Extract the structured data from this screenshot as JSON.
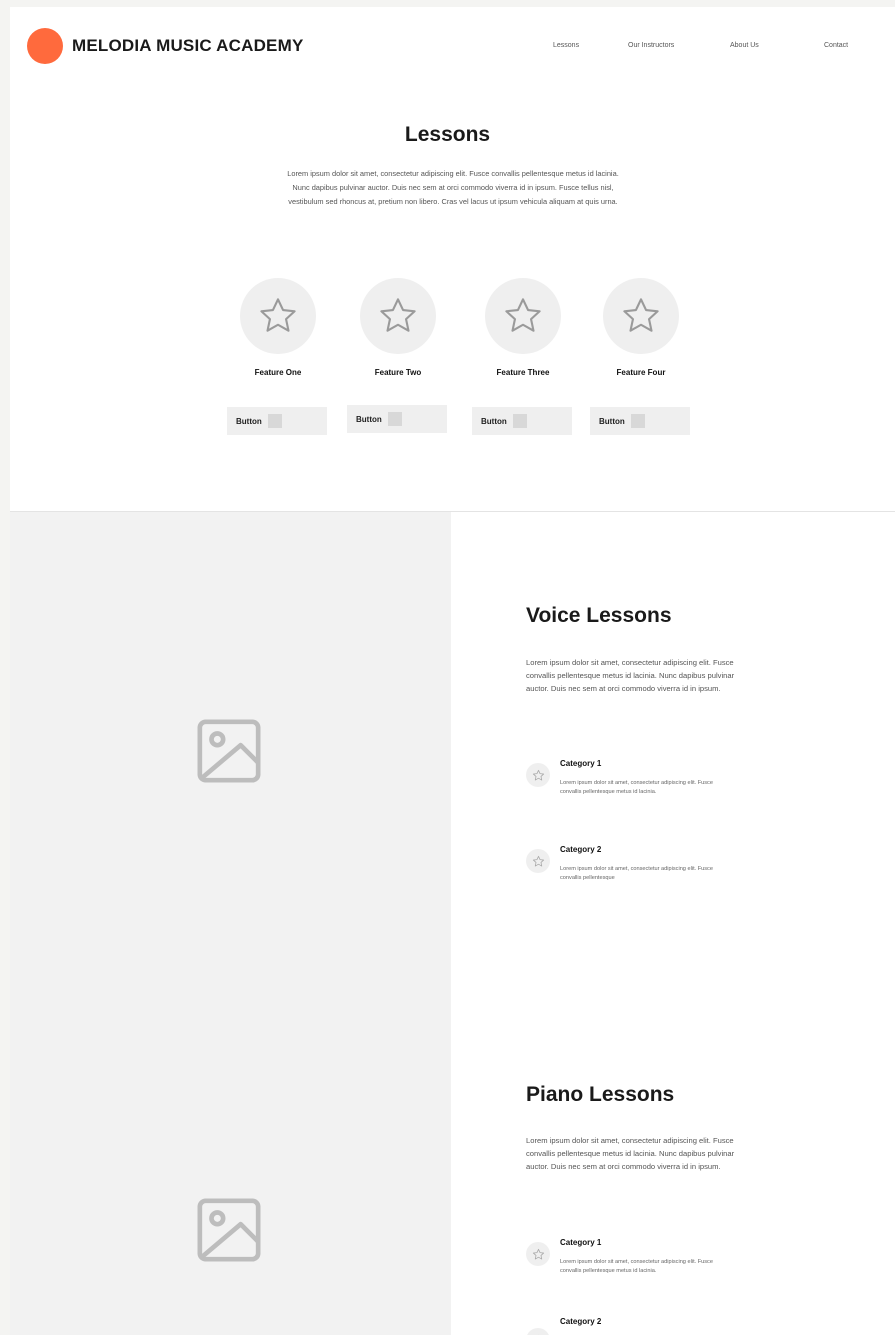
{
  "header": {
    "brand": "MELODIA MUSIC ACADEMY",
    "brand_color": "#ff6a3d",
    "nav": [
      "Lessons",
      "Our Instructors",
      "About Us",
      "Contact"
    ]
  },
  "lessons": {
    "title": "Lessons",
    "description": "Lorem ipsum dolor sit amet, consectetur adipiscing elit. Fusce convallis pellentesque metus id lacinia. Nunc dapibus pulvinar auctor. Duis nec sem at orci commodo viverra id in ipsum. Fusce tellus nisl, vestibulum sed rhoncus at, pretium non libero. Cras vel lacus ut ipsum vehicula aliquam at quis urna.",
    "features": [
      {
        "label": "Feature One",
        "icon": "star-icon",
        "button": "Button"
      },
      {
        "label": "Feature Two",
        "icon": "star-icon",
        "button": "Button"
      },
      {
        "label": "Feature Three",
        "icon": "star-icon",
        "button": "Button"
      },
      {
        "label": "Feature Four",
        "icon": "star-icon",
        "button": "Button"
      }
    ]
  },
  "sections": [
    {
      "title": "Voice Lessons",
      "description": "Lorem ipsum dolor sit amet, consectetur adipiscing elit. Fusce convallis pellentesque metus id lacinia. Nunc dapibus pulvinar auctor. Duis nec sem at orci commodo viverra id in ipsum.",
      "image_icon": "image-placeholder-icon",
      "categories": [
        {
          "title": "Category 1",
          "description": "Lorem ipsum dolor sit amet, consectetur adipiscing elit. Fusce convallis pellentesque metus id lacinia."
        },
        {
          "title": "Category 2",
          "description": "Lorem ipsum dolor sit amet, consectetur adipiscing elit. Fusce convallis pellentesque"
        }
      ]
    },
    {
      "title": "Piano Lessons",
      "description": "Lorem ipsum dolor sit amet, consectetur adipiscing elit. Fusce convallis pellentesque metus id lacinia. Nunc dapibus pulvinar auctor. Duis nec sem at orci commodo viverra id in ipsum.",
      "image_icon": "image-placeholder-icon",
      "categories": [
        {
          "title": "Category 1",
          "description": "Lorem ipsum dolor sit amet, consectetur adipiscing elit. Fusce convallis pellentesque metus id lacinia."
        },
        {
          "title": "Category 2",
          "description": ""
        }
      ]
    }
  ]
}
